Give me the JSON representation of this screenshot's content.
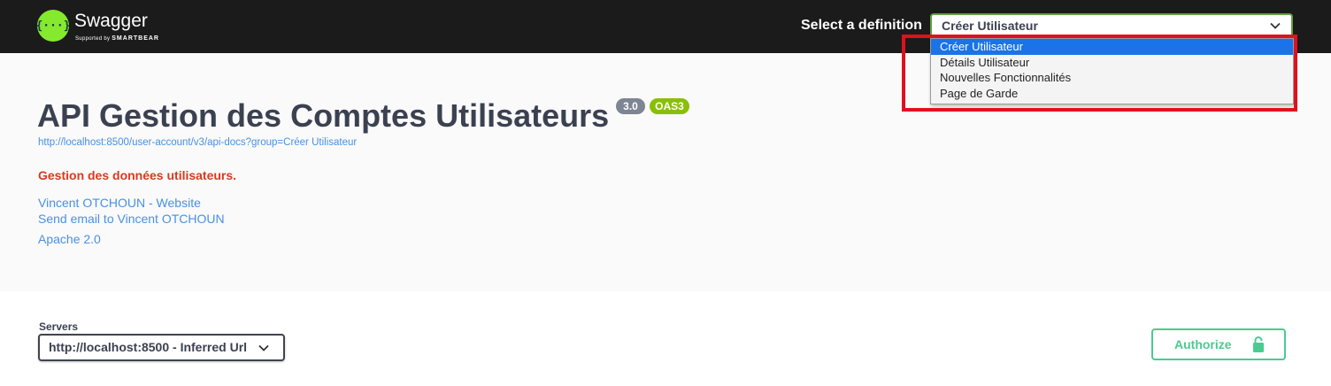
{
  "header": {
    "brand": "Swagger",
    "brand_sub_prefix": "Supported by",
    "brand_sub_company": "SMARTBEAR",
    "definition_label": "Select a definition",
    "definition_selected": "Créer Utilisateur",
    "definition_options": [
      "Créer Utilisateur",
      "Détails Utilisateur",
      "Nouvelles Fonctionnalités",
      "Page de Garde"
    ]
  },
  "info": {
    "title": "API Gestion des Comptes Utilisateurs",
    "version_badge": "3.0",
    "oas_badge": "OAS3",
    "url": "http://localhost:8500/user-account/v3/api-docs?group=Créer Utilisateur",
    "description": "Gestion des données utilisateurs.",
    "links": {
      "website": "Vincent OTCHOUN - Website",
      "email": "Send email to Vincent OTCHOUN",
      "license": "Apache 2.0"
    }
  },
  "servers": {
    "label": "Servers",
    "selected": "http://localhost:8500 - Inferred Url"
  },
  "authorize": {
    "label": "Authorize"
  },
  "colors": {
    "topbar": "#1b1b1b",
    "swagger_green": "#85ea2d",
    "link_blue": "#4990e2",
    "description_red": "#d53b1e",
    "authorize_green": "#49cc90",
    "highlight_red": "#e0101f",
    "option_selected": "#1a73e8"
  }
}
